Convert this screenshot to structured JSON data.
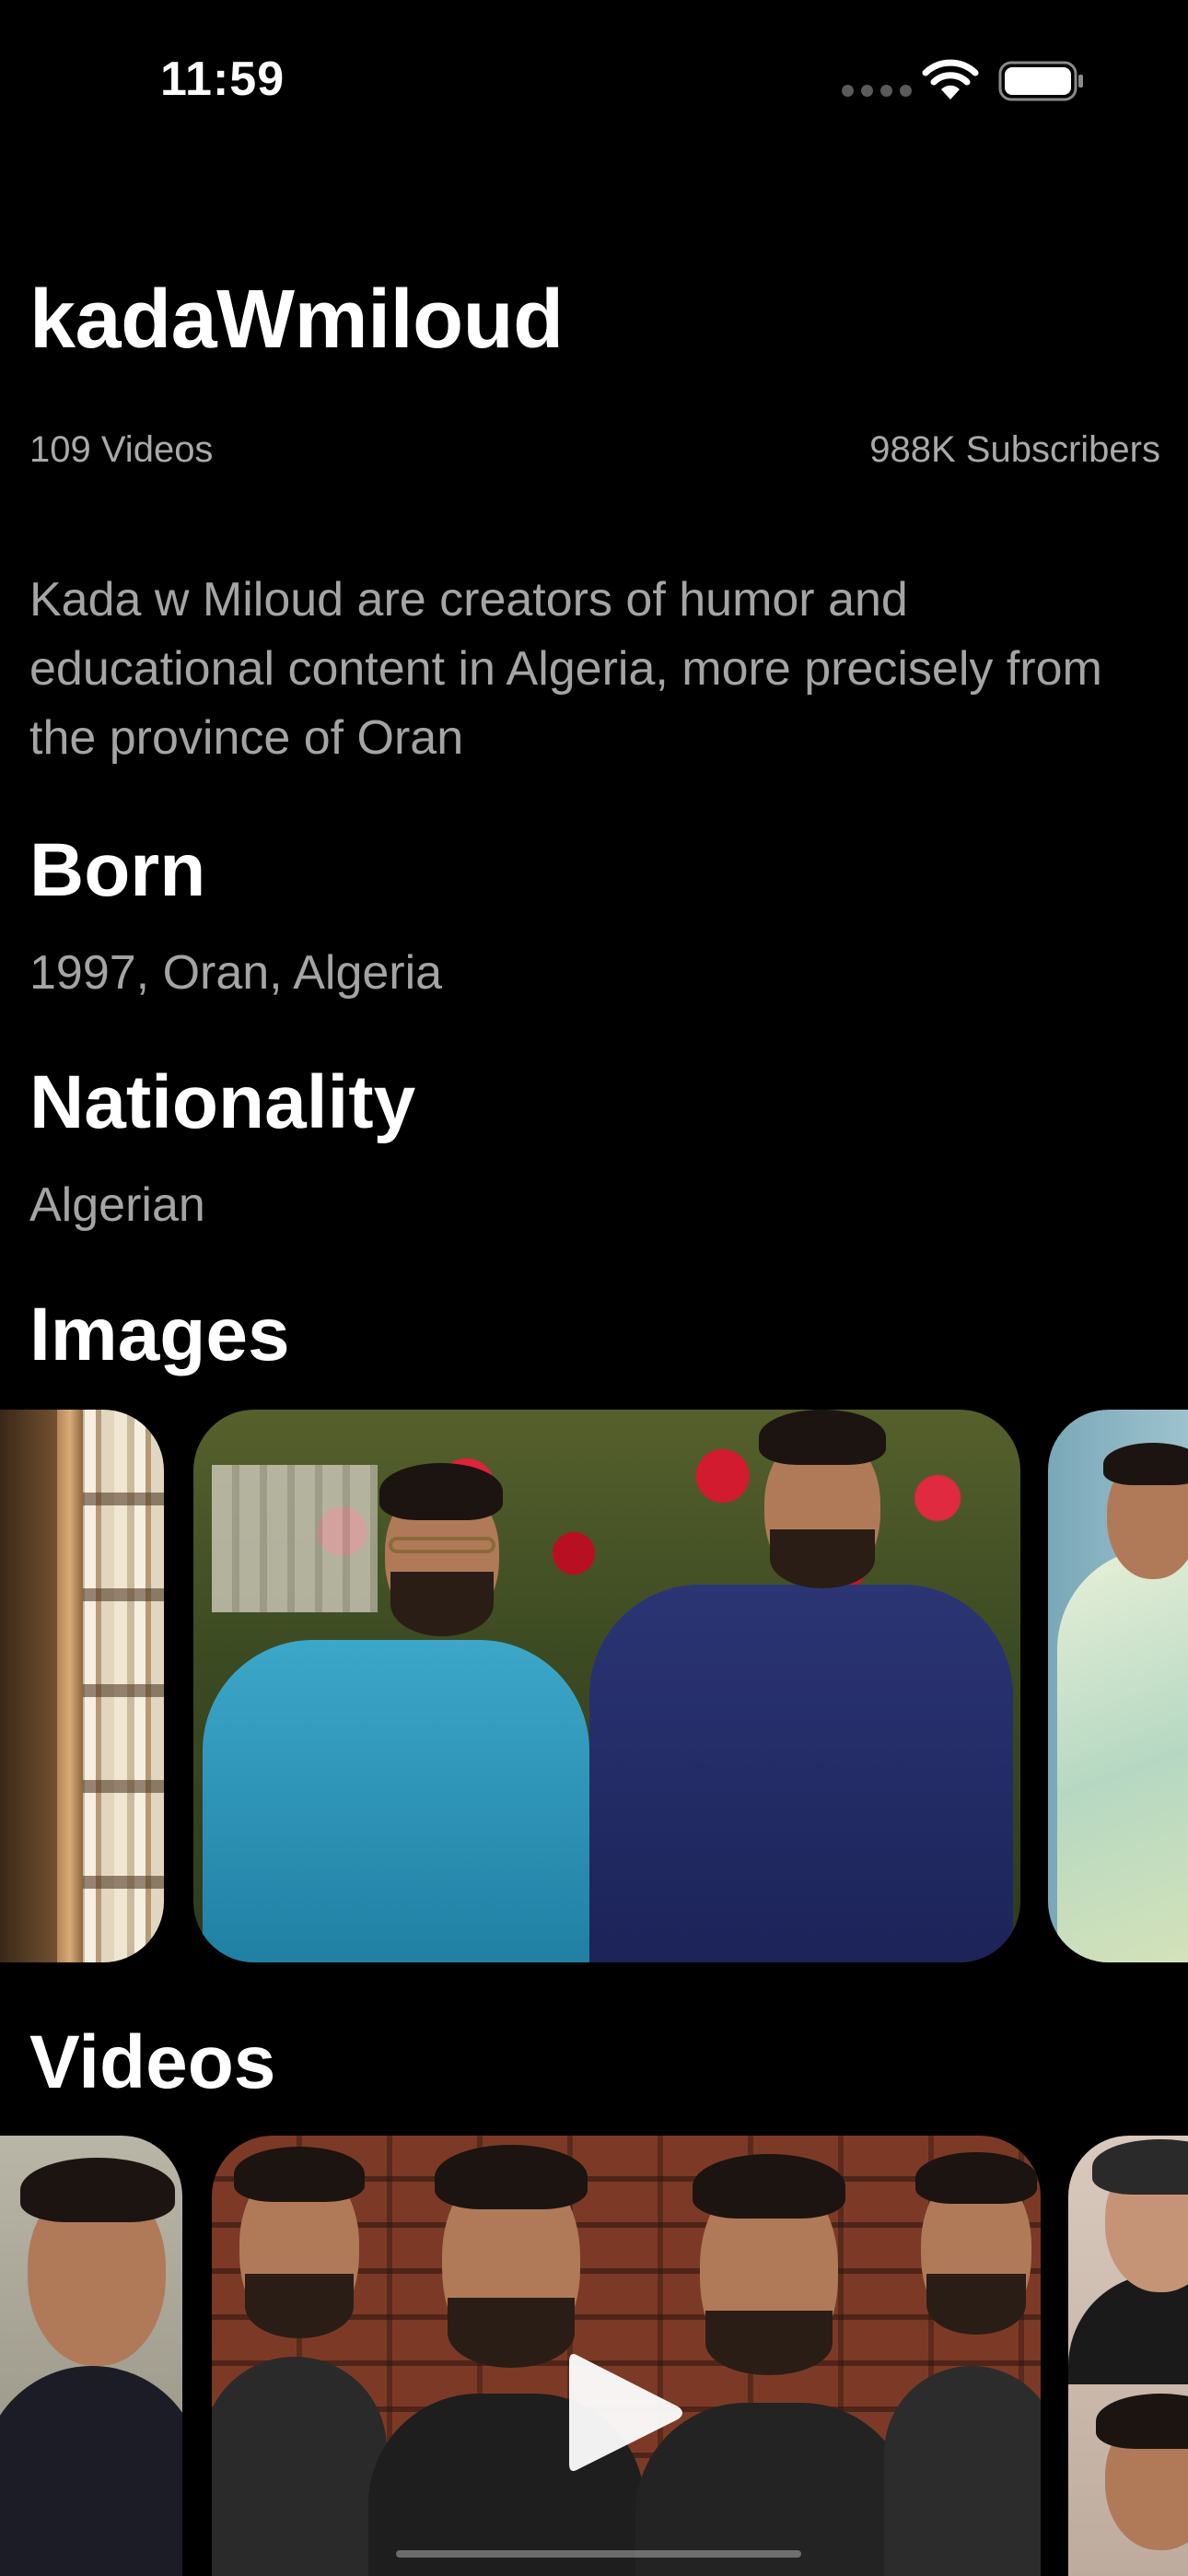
{
  "status_bar": {
    "time": "11:59",
    "icons": [
      "signal-dots-icon",
      "wifi-icon",
      "battery-icon"
    ]
  },
  "channel": {
    "name": "kadaWmiloud",
    "videos_label": "109 Videos",
    "subscribers_label": "988K Subscribers",
    "description": "Kada w Miloud are creators of humor and educational content in Algeria, more precisely from the province of Oran"
  },
  "born": {
    "heading": "Born",
    "value": "1997, Oran, Algeria"
  },
  "nationality": {
    "heading": "Nationality",
    "value": "Algerian"
  },
  "images": {
    "heading": "Images",
    "items": [
      "bookshelf photo",
      "two men in traditional robes photo",
      "man in pastel shirt photo"
    ]
  },
  "videos": {
    "heading": "Videos",
    "items": [
      "video thumbnail left",
      "video thumbnail main",
      "video thumbnail right"
    ],
    "play_icon": "play-icon"
  },
  "colors": {
    "background": "#000000",
    "primary_text": "#ffffff",
    "secondary_text": "#a4a4a4"
  }
}
